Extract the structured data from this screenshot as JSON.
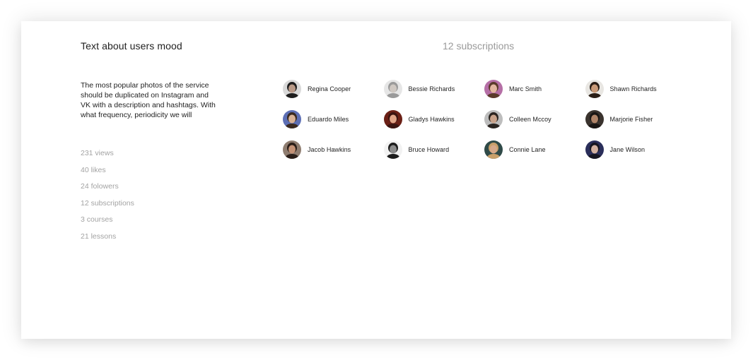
{
  "profile": {
    "mood_title": "Text about users mood",
    "description": "The most popular photos of the service should be duplicated on Instagram and VK with a description and hashtags. With what frequency, periodicity we will",
    "stats": [
      "231 views",
      "40 likes",
      "24 folowers",
      "12 subscriptions",
      "3 courses",
      "21 lessons"
    ]
  },
  "subscriptions": {
    "title": "12 subscriptions",
    "users": [
      {
        "name": "Regina Cooper",
        "bg": "#d9d9d9",
        "hair": "#1e1e1e",
        "skin": "#b99a88"
      },
      {
        "name": "Bessie Richards",
        "bg": "#e6e6e6",
        "hair": "#9a9a9a",
        "skin": "#cfc8c2"
      },
      {
        "name": "Marc Smith",
        "bg": "#b56fa6",
        "hair": "#5a3a2a",
        "skin": "#e3b6a0"
      },
      {
        "name": "Shawn Richards",
        "bg": "#e8e6e2",
        "hair": "#2a1e16",
        "skin": "#c99a78"
      },
      {
        "name": "Eduardo Miles",
        "bg": "#5d6fb5",
        "hair": "#3a2a20",
        "skin": "#d8b296"
      },
      {
        "name": "Gladys Hawkins",
        "bg": "#6b2016",
        "hair": "#3a1410",
        "skin": "#e0a487"
      },
      {
        "name": "Colleen Mccoy",
        "bg": "#bdbdbd",
        "hair": "#2a2420",
        "skin": "#c8a28a"
      },
      {
        "name": "Marjorie Fisher",
        "bg": "#3a332e",
        "hair": "#1a1614",
        "skin": "#b08468"
      },
      {
        "name": "Jacob Hawkins",
        "bg": "#8f7d70",
        "hair": "#2a1e18",
        "skin": "#c49276"
      },
      {
        "name": "Bruce Howard",
        "bg": "#f2f2f2",
        "hair": "#1c1c1c",
        "skin": "#8c8c8c"
      },
      {
        "name": "Connie Lane",
        "bg": "#2f4a48",
        "hair": "#c9a06a",
        "skin": "#d6a98a"
      },
      {
        "name": "Jane Wilson",
        "bg": "#2a2e5a",
        "hair": "#151520",
        "skin": "#d2b0a0"
      }
    ]
  }
}
